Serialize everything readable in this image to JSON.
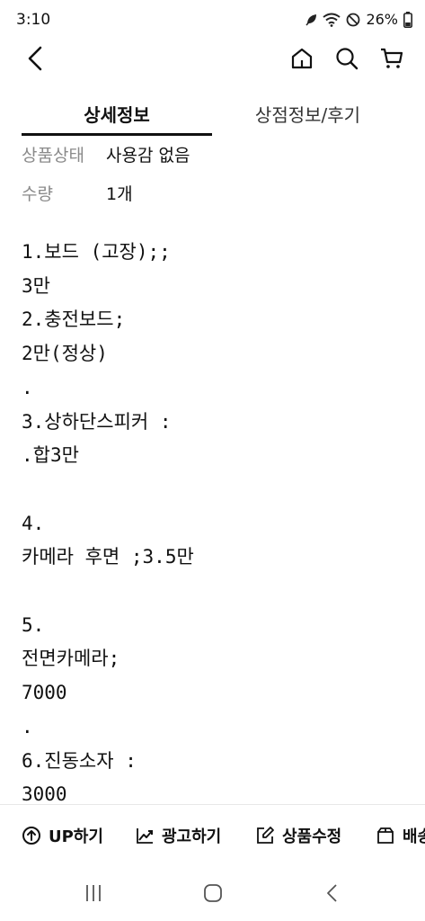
{
  "status": {
    "time": "3:10",
    "battery": "26%",
    "icons": [
      "leaf-icon",
      "wifi-icon",
      "do-not-disturb-icon"
    ]
  },
  "header": {
    "icons": [
      "back-icon",
      "home-icon",
      "search-icon",
      "cart-icon"
    ]
  },
  "tabs": [
    {
      "label": "상세정보",
      "active": true
    },
    {
      "label": "상점정보/후기",
      "active": false
    }
  ],
  "info": {
    "condition_label": "상품상태",
    "condition_value": "사용감 없음",
    "quantity_label": "수량",
    "quantity_value": "1개"
  },
  "description": "1.보드 (고장);;\n3만\n2.충전보드;\n2만(정상)\n.\n3.상하단스피커 :\n.합3만\n\n4.\n카메라 후면 ;3.5만\n\n5.\n전면카메라;\n7000\n.\n6.진동소자 :\n3000",
  "actions": [
    {
      "label": "UP하기",
      "icon": "up-circle-icon"
    },
    {
      "label": "광고하기",
      "icon": "trend-chart-icon"
    },
    {
      "label": "상품수정",
      "icon": "edit-icon"
    },
    {
      "label": "배송",
      "icon": "box-icon"
    }
  ],
  "nav": {
    "icons": [
      "recent-apps-icon",
      "home-nav-icon",
      "back-nav-icon"
    ]
  }
}
